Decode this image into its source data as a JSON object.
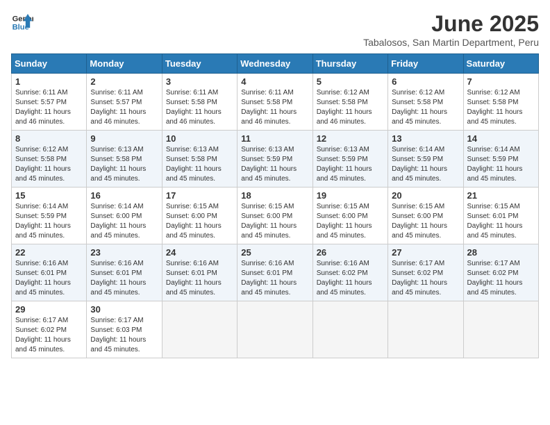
{
  "logo": {
    "line1": "General",
    "line2": "Blue"
  },
  "title": "June 2025",
  "subtitle": "Tabalosos, San Martin Department, Peru",
  "headers": [
    "Sunday",
    "Monday",
    "Tuesday",
    "Wednesday",
    "Thursday",
    "Friday",
    "Saturday"
  ],
  "weeks": [
    [
      {
        "day": "1",
        "text": "Sunrise: 6:11 AM\nSunset: 5:57 PM\nDaylight: 11 hours\nand 46 minutes."
      },
      {
        "day": "2",
        "text": "Sunrise: 6:11 AM\nSunset: 5:57 PM\nDaylight: 11 hours\nand 46 minutes."
      },
      {
        "day": "3",
        "text": "Sunrise: 6:11 AM\nSunset: 5:58 PM\nDaylight: 11 hours\nand 46 minutes."
      },
      {
        "day": "4",
        "text": "Sunrise: 6:11 AM\nSunset: 5:58 PM\nDaylight: 11 hours\nand 46 minutes."
      },
      {
        "day": "5",
        "text": "Sunrise: 6:12 AM\nSunset: 5:58 PM\nDaylight: 11 hours\nand 46 minutes."
      },
      {
        "day": "6",
        "text": "Sunrise: 6:12 AM\nSunset: 5:58 PM\nDaylight: 11 hours\nand 45 minutes."
      },
      {
        "day": "7",
        "text": "Sunrise: 6:12 AM\nSunset: 5:58 PM\nDaylight: 11 hours\nand 45 minutes."
      }
    ],
    [
      {
        "day": "8",
        "text": "Sunrise: 6:12 AM\nSunset: 5:58 PM\nDaylight: 11 hours\nand 45 minutes."
      },
      {
        "day": "9",
        "text": "Sunrise: 6:13 AM\nSunset: 5:58 PM\nDaylight: 11 hours\nand 45 minutes."
      },
      {
        "day": "10",
        "text": "Sunrise: 6:13 AM\nSunset: 5:58 PM\nDaylight: 11 hours\nand 45 minutes."
      },
      {
        "day": "11",
        "text": "Sunrise: 6:13 AM\nSunset: 5:59 PM\nDaylight: 11 hours\nand 45 minutes."
      },
      {
        "day": "12",
        "text": "Sunrise: 6:13 AM\nSunset: 5:59 PM\nDaylight: 11 hours\nand 45 minutes."
      },
      {
        "day": "13",
        "text": "Sunrise: 6:14 AM\nSunset: 5:59 PM\nDaylight: 11 hours\nand 45 minutes."
      },
      {
        "day": "14",
        "text": "Sunrise: 6:14 AM\nSunset: 5:59 PM\nDaylight: 11 hours\nand 45 minutes."
      }
    ],
    [
      {
        "day": "15",
        "text": "Sunrise: 6:14 AM\nSunset: 5:59 PM\nDaylight: 11 hours\nand 45 minutes."
      },
      {
        "day": "16",
        "text": "Sunrise: 6:14 AM\nSunset: 6:00 PM\nDaylight: 11 hours\nand 45 minutes."
      },
      {
        "day": "17",
        "text": "Sunrise: 6:15 AM\nSunset: 6:00 PM\nDaylight: 11 hours\nand 45 minutes."
      },
      {
        "day": "18",
        "text": "Sunrise: 6:15 AM\nSunset: 6:00 PM\nDaylight: 11 hours\nand 45 minutes."
      },
      {
        "day": "19",
        "text": "Sunrise: 6:15 AM\nSunset: 6:00 PM\nDaylight: 11 hours\nand 45 minutes."
      },
      {
        "day": "20",
        "text": "Sunrise: 6:15 AM\nSunset: 6:00 PM\nDaylight: 11 hours\nand 45 minutes."
      },
      {
        "day": "21",
        "text": "Sunrise: 6:15 AM\nSunset: 6:01 PM\nDaylight: 11 hours\nand 45 minutes."
      }
    ],
    [
      {
        "day": "22",
        "text": "Sunrise: 6:16 AM\nSunset: 6:01 PM\nDaylight: 11 hours\nand 45 minutes."
      },
      {
        "day": "23",
        "text": "Sunrise: 6:16 AM\nSunset: 6:01 PM\nDaylight: 11 hours\nand 45 minutes."
      },
      {
        "day": "24",
        "text": "Sunrise: 6:16 AM\nSunset: 6:01 PM\nDaylight: 11 hours\nand 45 minutes."
      },
      {
        "day": "25",
        "text": "Sunrise: 6:16 AM\nSunset: 6:01 PM\nDaylight: 11 hours\nand 45 minutes."
      },
      {
        "day": "26",
        "text": "Sunrise: 6:16 AM\nSunset: 6:02 PM\nDaylight: 11 hours\nand 45 minutes."
      },
      {
        "day": "27",
        "text": "Sunrise: 6:17 AM\nSunset: 6:02 PM\nDaylight: 11 hours\nand 45 minutes."
      },
      {
        "day": "28",
        "text": "Sunrise: 6:17 AM\nSunset: 6:02 PM\nDaylight: 11 hours\nand 45 minutes."
      }
    ],
    [
      {
        "day": "29",
        "text": "Sunrise: 6:17 AM\nSunset: 6:02 PM\nDaylight: 11 hours\nand 45 minutes."
      },
      {
        "day": "30",
        "text": "Sunrise: 6:17 AM\nSunset: 6:03 PM\nDaylight: 11 hours\nand 45 minutes."
      },
      {
        "day": "",
        "text": ""
      },
      {
        "day": "",
        "text": ""
      },
      {
        "day": "",
        "text": ""
      },
      {
        "day": "",
        "text": ""
      },
      {
        "day": "",
        "text": ""
      }
    ]
  ]
}
